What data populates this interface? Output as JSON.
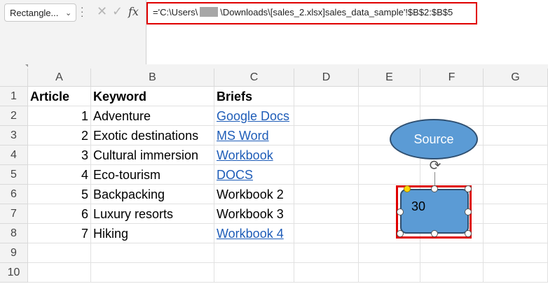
{
  "namebox": {
    "value": "Rectangle...",
    "chevron_icon": "chevron-down-icon"
  },
  "formula_bar": {
    "formula_prefix": "='C:\\Users\\",
    "formula_suffix": "\\Downloads\\[sales_2.xlsx]sales_data_sample'!$B$2:$B$5",
    "cancel_icon": "x-icon",
    "enter_icon": "check-icon",
    "function_icon": "fx-icon",
    "fx_label": "fx"
  },
  "columns": [
    "A",
    "B",
    "C",
    "D",
    "E",
    "F",
    "G"
  ],
  "rows": [
    "1",
    "2",
    "3",
    "4",
    "5",
    "6",
    "7",
    "8",
    "9",
    "10"
  ],
  "table": {
    "headers": {
      "a": "Article",
      "b": "Keyword",
      "c": "Briefs"
    },
    "rows": [
      {
        "a": "1",
        "b": "Adventure",
        "c": "Google Docs",
        "c_link": true
      },
      {
        "a": "2",
        "b": "Exotic destinations",
        "c": "MS Word",
        "c_link": true
      },
      {
        "a": "3",
        "b": "Cultural immersion",
        "c": "Workbook",
        "c_link": true
      },
      {
        "a": "4",
        "b": "Eco-tourism",
        "c": "DOCS",
        "c_link": true
      },
      {
        "a": "5",
        "b": "Backpacking",
        "c": "Workbook 2",
        "c_link": false
      },
      {
        "a": "6",
        "b": "Luxury resorts",
        "c": "Workbook 3",
        "c_link": false
      },
      {
        "a": "7",
        "b": "Hiking",
        "c": "Workbook 4",
        "c_link": true
      }
    ]
  },
  "shapes": {
    "ellipse_label": "Source",
    "rectangle_label": "30",
    "rotate_icon": "rotate-icon"
  },
  "colors": {
    "shape_fill": "#5b9bd5",
    "highlight": "#e00000",
    "link": "#1f5db8"
  }
}
